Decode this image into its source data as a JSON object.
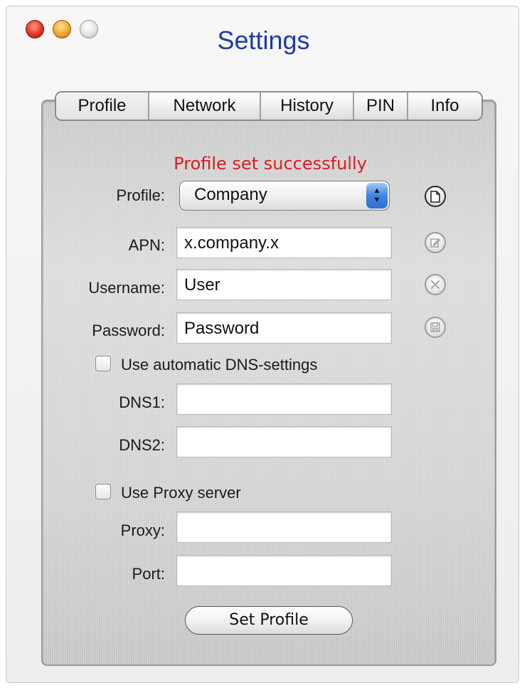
{
  "window": {
    "title": "Settings"
  },
  "tabs": [
    {
      "label": "Profile",
      "selected": true
    },
    {
      "label": "Network"
    },
    {
      "label": "History"
    },
    {
      "label": "PIN"
    },
    {
      "label": "Info"
    }
  ],
  "status": {
    "text": "Profile set successfully",
    "color": "#d81e1e"
  },
  "form": {
    "profile": {
      "label": "Profile:",
      "value": "Company"
    },
    "apn": {
      "label": "APN:",
      "value": "x.company.x"
    },
    "username": {
      "label": "Username:",
      "value": "User"
    },
    "password": {
      "label": "Password:",
      "value": "Password"
    },
    "dns_checkbox": {
      "label": "Use automatic DNS-settings",
      "checked": false
    },
    "dns1": {
      "label": "DNS1:",
      "value": ""
    },
    "dns2": {
      "label": "DNS2:",
      "value": ""
    },
    "proxy_checkbox": {
      "label": "Use Proxy server",
      "checked": false
    },
    "proxy": {
      "label": "Proxy:",
      "value": ""
    },
    "port": {
      "label": "Port:",
      "value": ""
    }
  },
  "side_buttons": [
    {
      "icon": "new-document-icon",
      "enabled": true
    },
    {
      "icon": "edit-icon",
      "enabled": false
    },
    {
      "icon": "delete-icon",
      "enabled": false
    },
    {
      "icon": "save-icon",
      "enabled": false
    }
  ],
  "actions": {
    "set_profile": "Set Profile"
  }
}
